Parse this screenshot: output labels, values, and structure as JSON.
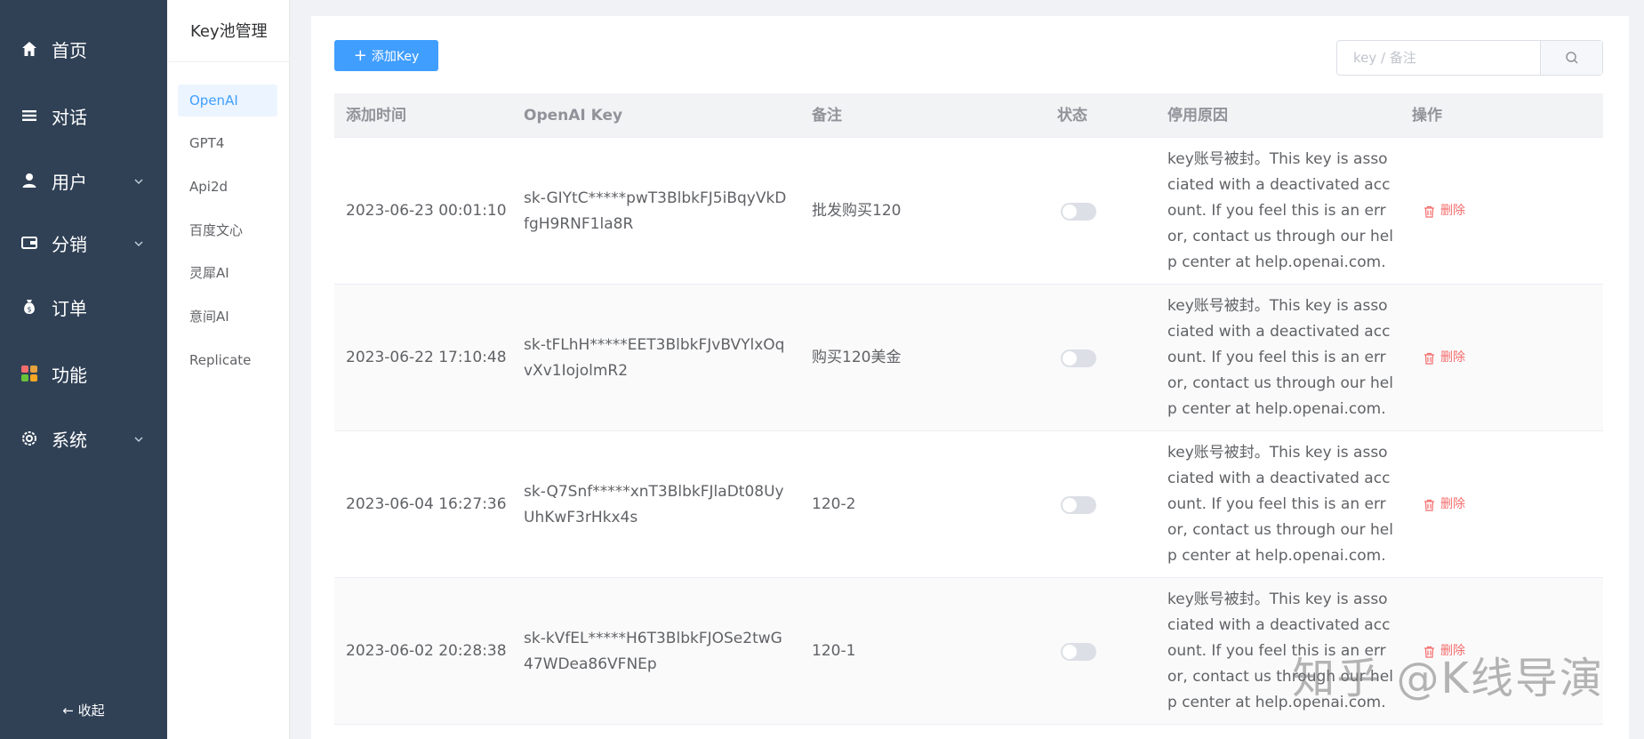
{
  "nav": {
    "items": [
      {
        "label": "首页",
        "icon": "home-icon"
      },
      {
        "label": "对话",
        "icon": "list-icon"
      },
      {
        "label": "用户",
        "icon": "user-icon",
        "has_children": true
      },
      {
        "label": "分销",
        "icon": "wallet-icon",
        "has_children": true
      },
      {
        "label": "订单",
        "icon": "moneybag-icon"
      },
      {
        "label": "功能",
        "icon": "apps-icon"
      },
      {
        "label": "系统",
        "icon": "gear-icon",
        "has_children": true
      }
    ],
    "collapse_label": "← 收起"
  },
  "subnav": {
    "title": "Key池管理",
    "items": [
      {
        "label": "OpenAI",
        "active": true
      },
      {
        "label": "GPT4"
      },
      {
        "label": "Api2d"
      },
      {
        "label": "百度文心"
      },
      {
        "label": "灵犀AI"
      },
      {
        "label": "意间AI"
      },
      {
        "label": "Replicate"
      }
    ]
  },
  "toolbar": {
    "add_label": "添加Key",
    "search_placeholder": "key / 备注"
  },
  "table": {
    "columns": [
      "添加时间",
      "OpenAI Key",
      "备注",
      "状态",
      "停用原因",
      "操作"
    ],
    "rows": [
      {
        "time": "2023-06-23 00:01:10",
        "key": "sk-GIYtC*****pwT3BlbkFJ5iBqyVkDfgH9RNF1la8R",
        "note": "批发购买120",
        "enabled": false,
        "reason": "key账号被封。This key is associated with a deactivated account. If you feel this is an error, contact us through our help center at help.openai.com.",
        "action": "删除"
      },
      {
        "time": "2023-06-22 17:10:48",
        "key": "sk-tFLhH*****EET3BlbkFJvBVYlxOqvXv1IojolmR2",
        "note": "购买120美金",
        "enabled": false,
        "reason": "key账号被封。This key is associated with a deactivated account. If you feel this is an error, contact us through our help center at help.openai.com.",
        "action": "删除"
      },
      {
        "time": "2023-06-04 16:27:36",
        "key": "sk-Q7Snf*****xnT3BlbkFJlaDt08UyUhKwF3rHkx4s",
        "note": "120-2",
        "enabled": false,
        "reason": "key账号被封。This key is associated with a deactivated account. If you feel this is an error, contact us through our help center at help.openai.com.",
        "action": "删除"
      },
      {
        "time": "2023-06-02 20:28:38",
        "key": "sk-kVfEL*****H6T3BlbkFJOSe2twG47WDea86VFNEp",
        "note": "120-1",
        "enabled": false,
        "reason": "key账号被封。This key is associated with a deactivated account. If you feel this is an error, contact us through our help center at help.openai.com.",
        "action": "删除"
      }
    ]
  },
  "watermark": "知乎 @K线导演",
  "colors": {
    "sidebar_bg": "#304156",
    "primary": "#409eff",
    "danger": "#f56c6c"
  }
}
